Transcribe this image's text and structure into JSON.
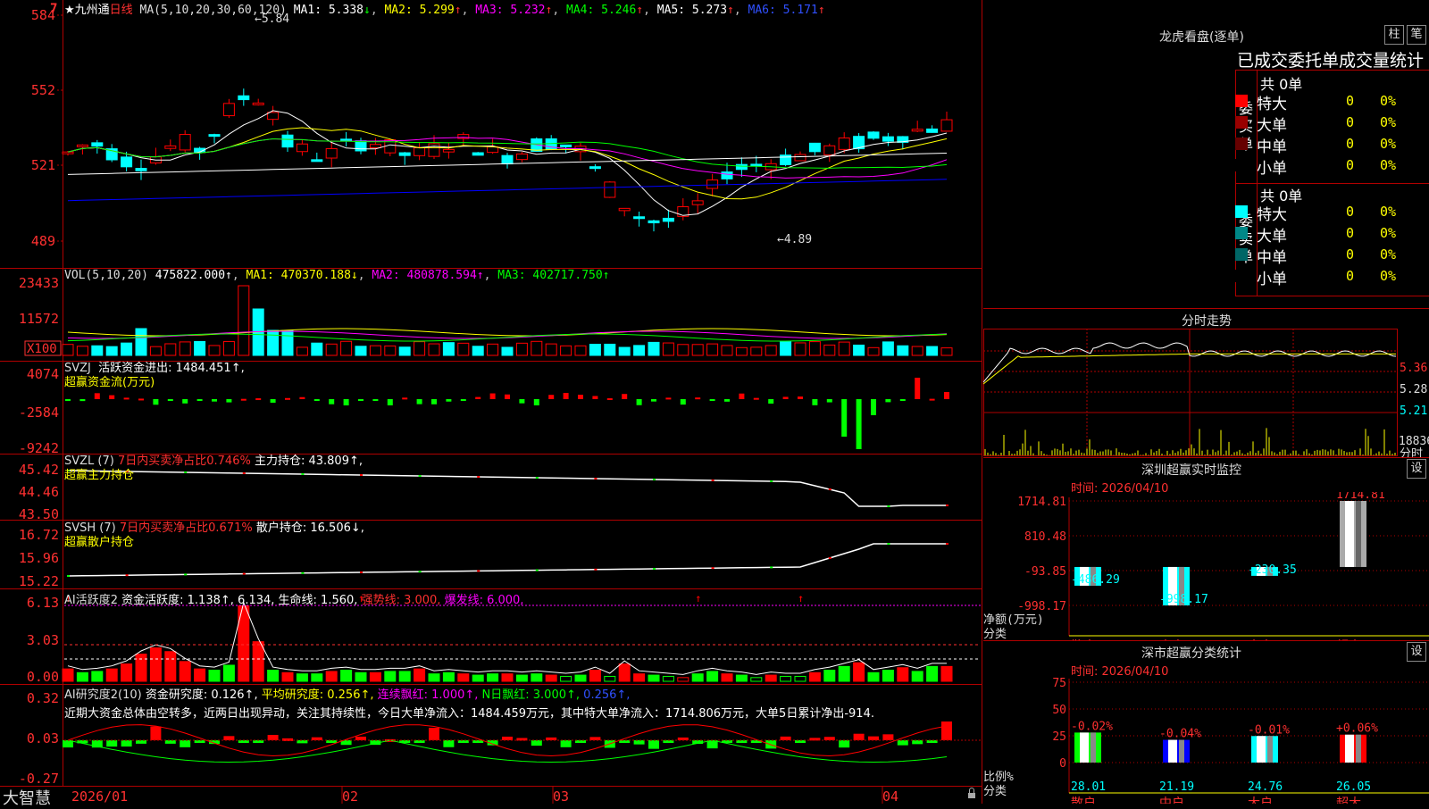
{
  "colors": {
    "up": "#ff0000",
    "down": "#00ffff",
    "green": "#00ff00",
    "ma1": "#ffffff",
    "ma2": "#ffff00",
    "ma3": "#ff00ff",
    "ma4": "#00ff00",
    "ma5": "#ffffff",
    "ma6": "#0000ff",
    "grid": "#b00000",
    "yellow": "#ffff00"
  },
  "kline": {
    "marker": "7",
    "stock_name": "★九州通",
    "period": "日线",
    "ma_label": "MA(5,10,20,30,60,120)",
    "ma": [
      {
        "name": "MA1",
        "value": "5.338",
        "arrow": "↓"
      },
      {
        "name": "MA2",
        "value": "5.299",
        "arrow": "↑"
      },
      {
        "name": "MA3",
        "value": "5.232",
        "arrow": "↑"
      },
      {
        "name": "MA4",
        "value": "5.246",
        "arrow": "↑"
      },
      {
        "name": "MA5",
        "value": "5.273",
        "arrow": "↑"
      },
      {
        "name": "MA6",
        "value": "5.171",
        "arrow": "↑"
      }
    ],
    "y_ticks": [
      "584",
      "552",
      "521",
      "489"
    ],
    "high_label": "5.84",
    "low_label": "4.89"
  },
  "vol": {
    "label": "VOL(5,10,20)",
    "value": "475822.000↑",
    "ma1": "MA1: 470370.188↓",
    "ma2": "MA2: 480878.594↑",
    "ma3": "MA3: 402717.750↑",
    "y_ticks": [
      "23433",
      "11572",
      "X100"
    ]
  },
  "svzj": {
    "label": "SVZJ",
    "item": "活跃资金进出: 1484.451↑,",
    "sub": "超赢资金流(万元)",
    "y_ticks": [
      "4074",
      "-2584",
      "-9242"
    ]
  },
  "svzl": {
    "label": "SVZL (7)",
    "item1": "7日内买卖净占比0.746%",
    "item2": "主力持仓: 43.809↑,",
    "sub": "超赢主力持仓",
    "y_ticks": [
      "45.42",
      "44.46",
      "43.50"
    ]
  },
  "svsh": {
    "label": "SVSH (7)",
    "item1": "7日内买卖净占比0.671%",
    "item2": "散户持仓: 16.506↓,",
    "sub": "超赢散户持仓",
    "y_ticks": [
      "16.72",
      "15.96",
      "15.22"
    ]
  },
  "ai": {
    "label": "AI活跃度2",
    "item1": "资金活跃度: 1.138↑,",
    "item2": "6.134,",
    "item3": "生命线: 1.560,",
    "item4": "强势线: 3.000,",
    "item5": "爆发线: 6.000,",
    "y_ticks": [
      "6.13",
      "3.03",
      "0.00"
    ]
  },
  "research": {
    "label": "AI研究度2(10)",
    "item1": "资金研究度: 0.126↑,",
    "item2": "平均研究度: 0.256↑,",
    "item3": "连续飘红: 1.000↑,",
    "item4": "N日飘红: 3.000↑,",
    "item5": "0.256↑,",
    "comment": "近期大资金总体由空转多，近两日出现异动，关注其持续性，今日大单净流入：1484.459万元，其中特大单净流入：1714.806万元，大单5日累计净出-914.",
    "y_ticks": [
      "0.32",
      "0.03",
      "-0.27"
    ]
  },
  "footer": {
    "brand": "大智慧",
    "dates": [
      "2026/01",
      "02",
      "03",
      "04"
    ]
  },
  "lhb": {
    "title": "龙虎看盘(逐单)",
    "tab1": "柱",
    "tab2": "笔",
    "heading": "已成交委托单成交量统计",
    "buy": {
      "label": "委买单",
      "total": "共 0单",
      "rows": [
        {
          "name": "特大",
          "count": "0",
          "pct": "0%",
          "color": "#ff0000"
        },
        {
          "name": "大单",
          "count": "0",
          "pct": "0%",
          "color": "#990000"
        },
        {
          "name": "中单",
          "count": "0",
          "pct": "0%",
          "color": "#660000"
        },
        {
          "name": "小单",
          "count": "0",
          "pct": "0%",
          "color": "#000000"
        }
      ]
    },
    "sell": {
      "label": "委卖单",
      "total": "共 0单",
      "rows": [
        {
          "name": "特大",
          "count": "0",
          "pct": "0%",
          "color": "#00ffff"
        },
        {
          "name": "大单",
          "count": "0",
          "pct": "0%",
          "color": "#008888"
        },
        {
          "name": "中单",
          "count": "0",
          "pct": "0%",
          "color": "#006666"
        },
        {
          "name": "小单",
          "count": "0",
          "pct": "0%",
          "color": "#000000"
        }
      ]
    }
  },
  "fenshi": {
    "title": "分时走势",
    "y_ticks": [
      "5.36",
      "5.28",
      "5.21"
    ],
    "vol_tick": "18836",
    "vol_label": "分时"
  },
  "monitor": {
    "title": "深圳超赢实时监控",
    "setting": "设",
    "time": "时间: 2026/04/10",
    "y_ticks": [
      "1714.81",
      "810.48",
      "-93.85",
      "-998.17"
    ],
    "ylabel": "净额(万元)",
    "xlabel": "分类",
    "bars": [
      {
        "cat": "散户",
        "value": "-486.29"
      },
      {
        "cat": "中户",
        "value": "-998.17"
      },
      {
        "cat": "大户",
        "value": "-230.35"
      },
      {
        "cat": "超大",
        "value": "1714.81"
      }
    ]
  },
  "classify": {
    "title": "深市超赢分类统计",
    "setting": "设",
    "time": "时间: 2026/04/10",
    "y_ticks": [
      "75",
      "50",
      "25",
      "0"
    ],
    "ylabel": "比例%",
    "xlabel": "分类",
    "bars": [
      {
        "cat": "散户",
        "value": "28.01",
        "delta": "-0.02%"
      },
      {
        "cat": "中户",
        "value": "21.19",
        "delta": "-0.04%"
      },
      {
        "cat": "大户",
        "value": "24.76",
        "delta": "-0.01%"
      },
      {
        "cat": "超大",
        "value": "26.05",
        "delta": "+0.06%"
      }
    ]
  },
  "chart_data": [
    {
      "type": "bar",
      "title": "深圳超赢实时监控",
      "categories": [
        "散户",
        "中户",
        "大户",
        "超大"
      ],
      "values": [
        -486.29,
        -998.17,
        -230.35,
        1714.81
      ],
      "ylabel": "净额(万元)",
      "xlabel": "分类",
      "ylim": [
        -998.17,
        1714.81
      ]
    },
    {
      "type": "bar",
      "title": "深市超赢分类统计",
      "categories": [
        "散户",
        "中户",
        "大户",
        "超大"
      ],
      "values": [
        28.01,
        21.19,
        24.76,
        26.05
      ],
      "ylabel": "比例%",
      "xlabel": "分类",
      "ylim": [
        0,
        75
      ]
    }
  ]
}
